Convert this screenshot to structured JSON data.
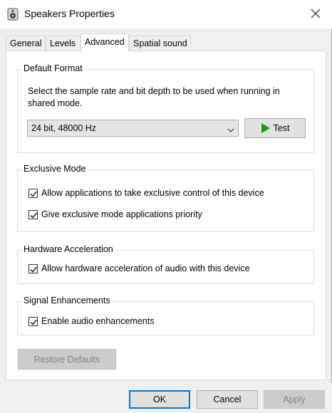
{
  "window": {
    "title": "Speakers Properties",
    "app_icon": "speaker-icon",
    "close_icon": "close-icon"
  },
  "tabs": [
    {
      "label": "General",
      "active": false
    },
    {
      "label": "Levels",
      "active": false
    },
    {
      "label": "Advanced",
      "active": true
    },
    {
      "label": "Spatial sound",
      "active": false
    }
  ],
  "default_format": {
    "title": "Default Format",
    "description": "Select the sample rate and bit depth to be used when running in shared mode.",
    "selected_value": "24 bit, 48000 Hz",
    "test_label": "Test",
    "test_icon": "play-icon"
  },
  "exclusive_mode": {
    "title": "Exclusive Mode",
    "items": [
      {
        "label": "Allow applications to take exclusive control of this device",
        "checked": true
      },
      {
        "label": "Give exclusive mode applications priority",
        "checked": true
      }
    ]
  },
  "hardware_acceleration": {
    "title": "Hardware Acceleration",
    "items": [
      {
        "label": "Allow hardware acceleration of audio with this device",
        "checked": true
      }
    ]
  },
  "signal_enhancements": {
    "title": "Signal Enhancements",
    "items": [
      {
        "label": "Enable audio enhancements",
        "checked": true
      }
    ]
  },
  "restore_defaults_label": "Restore Defaults",
  "footer": {
    "ok_label": "OK",
    "cancel_label": "Cancel",
    "apply_label": "Apply"
  },
  "colors": {
    "accent": "#0078d7",
    "play_green": "#1a9b1a"
  }
}
